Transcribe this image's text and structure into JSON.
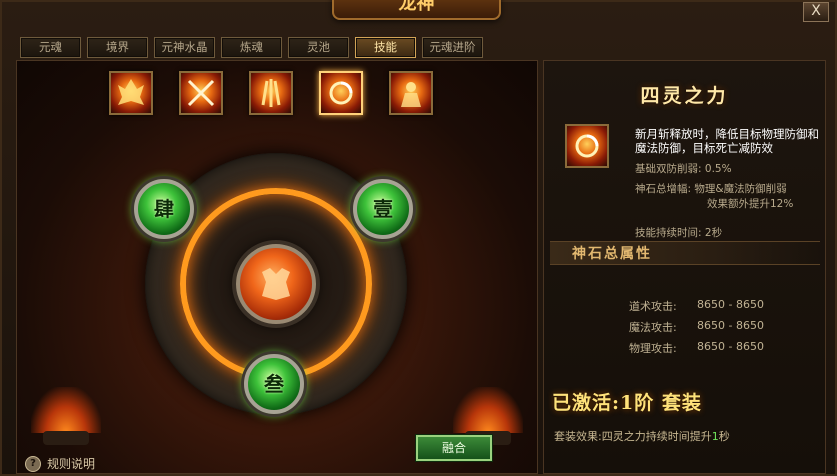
{
  "window": {
    "title": "龙神",
    "close_label": "X"
  },
  "tabs": [
    {
      "label": "元魂",
      "active": false
    },
    {
      "label": "境界",
      "active": false
    },
    {
      "label": "元神水晶",
      "active": false
    },
    {
      "label": "炼魂",
      "active": false
    },
    {
      "label": "灵池",
      "active": false
    },
    {
      "label": "技能",
      "active": true
    },
    {
      "label": "元魂进阶",
      "active": false
    }
  ],
  "skills": [
    {
      "icon": "demon-flame-icon",
      "selected": false
    },
    {
      "icon": "crossed-blades-icon",
      "selected": false
    },
    {
      "icon": "fire-claw-icon",
      "selected": false
    },
    {
      "icon": "four-spirit-orb-icon",
      "selected": true
    },
    {
      "icon": "flame-warrior-icon",
      "selected": false
    }
  ],
  "altar": {
    "nodes": {
      "left": "肆",
      "right": "壹",
      "bottom": "叁"
    },
    "fuse_label": "融合",
    "help_label": "规则说明"
  },
  "panel": {
    "skill_name": "四灵之力",
    "description": "新月斩释放时，降低目标物理防御和魔法防御，目标死亡减防效",
    "base_label": "基础双防削弱:",
    "base_value": "0.5%",
    "bonus_label": "神石总增幅:",
    "bonus_value_1": "物理&魔法防御削弱",
    "bonus_value_2": "效果额外提升12%",
    "duration_label": "技能持续时间:",
    "duration_value": "2秒",
    "section_title": "神石总属性",
    "attributes": [
      {
        "label": "道术攻击:",
        "value": "8650 - 8650"
      },
      {
        "label": "魔法攻击:",
        "value": "8650 - 8650"
      },
      {
        "label": "物理攻击:",
        "value": "8650 - 8650"
      }
    ],
    "set_title": "已激活:1阶 套装",
    "set_effect_prefix": "套装效果:四灵之力持续时间提升",
    "set_effect_value": "1",
    "set_effect_suffix": "秒"
  },
  "colors": {
    "accent_gold": "#ffce6a",
    "node_green": "#3ec23a",
    "fire_orange": "#ff9a1e",
    "highlight_green": "#6fe35c"
  }
}
